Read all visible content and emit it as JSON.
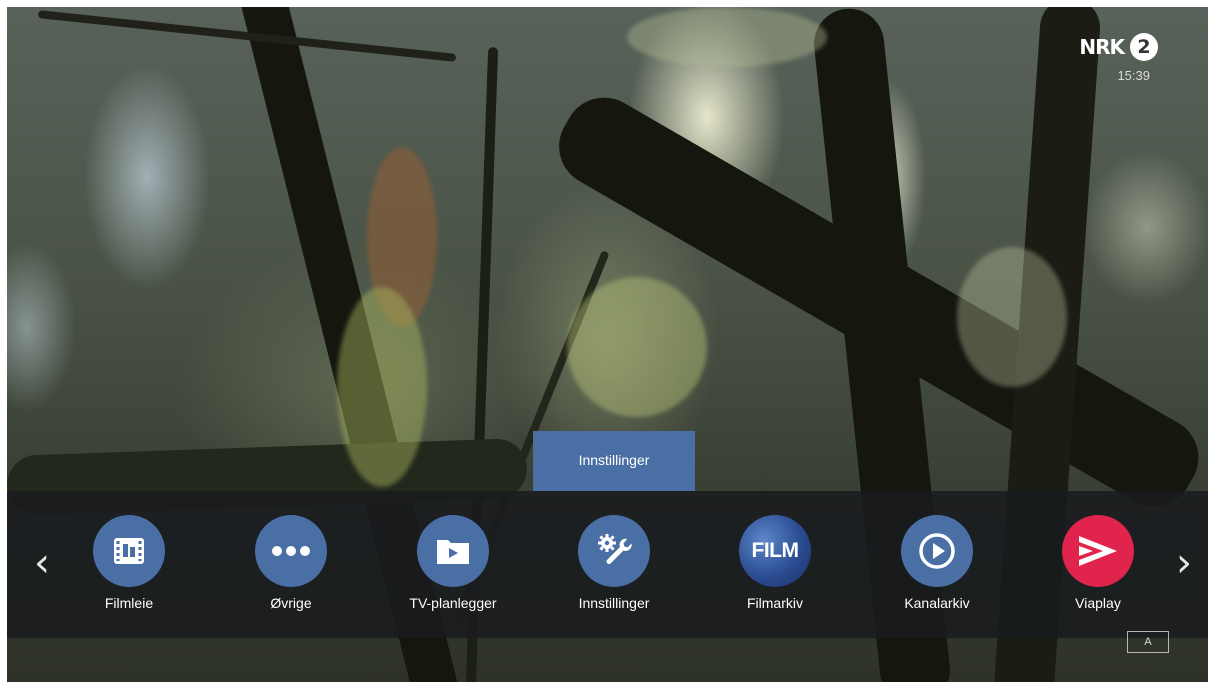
{
  "channel": {
    "logo_text": "NRK",
    "logo_number": "2",
    "clock": "15:39"
  },
  "focused_item_label": "Innstillinger",
  "menu": {
    "prev_arrow": "‹",
    "next_arrow": "›",
    "items": [
      {
        "label": "Filmleie",
        "icon": "film-rental-icon"
      },
      {
        "label": "Øvrige",
        "icon": "more-dots-icon"
      },
      {
        "label": "TV-planlegger",
        "icon": "folder-play-icon"
      },
      {
        "label": "Innstillinger",
        "icon": "settings-tools-icon"
      },
      {
        "label": "Filmarkiv",
        "icon": "film-archive-icon",
        "icon_text": "FILM"
      },
      {
        "label": "Kanalarkiv",
        "icon": "play-circle-icon"
      },
      {
        "label": "Viaplay",
        "icon": "viaplay-logo-icon"
      }
    ]
  },
  "corner_badge": "A",
  "colors": {
    "accent": "#4a6fa5",
    "bar": "#181b1e",
    "viaplay": "#e1244c"
  }
}
